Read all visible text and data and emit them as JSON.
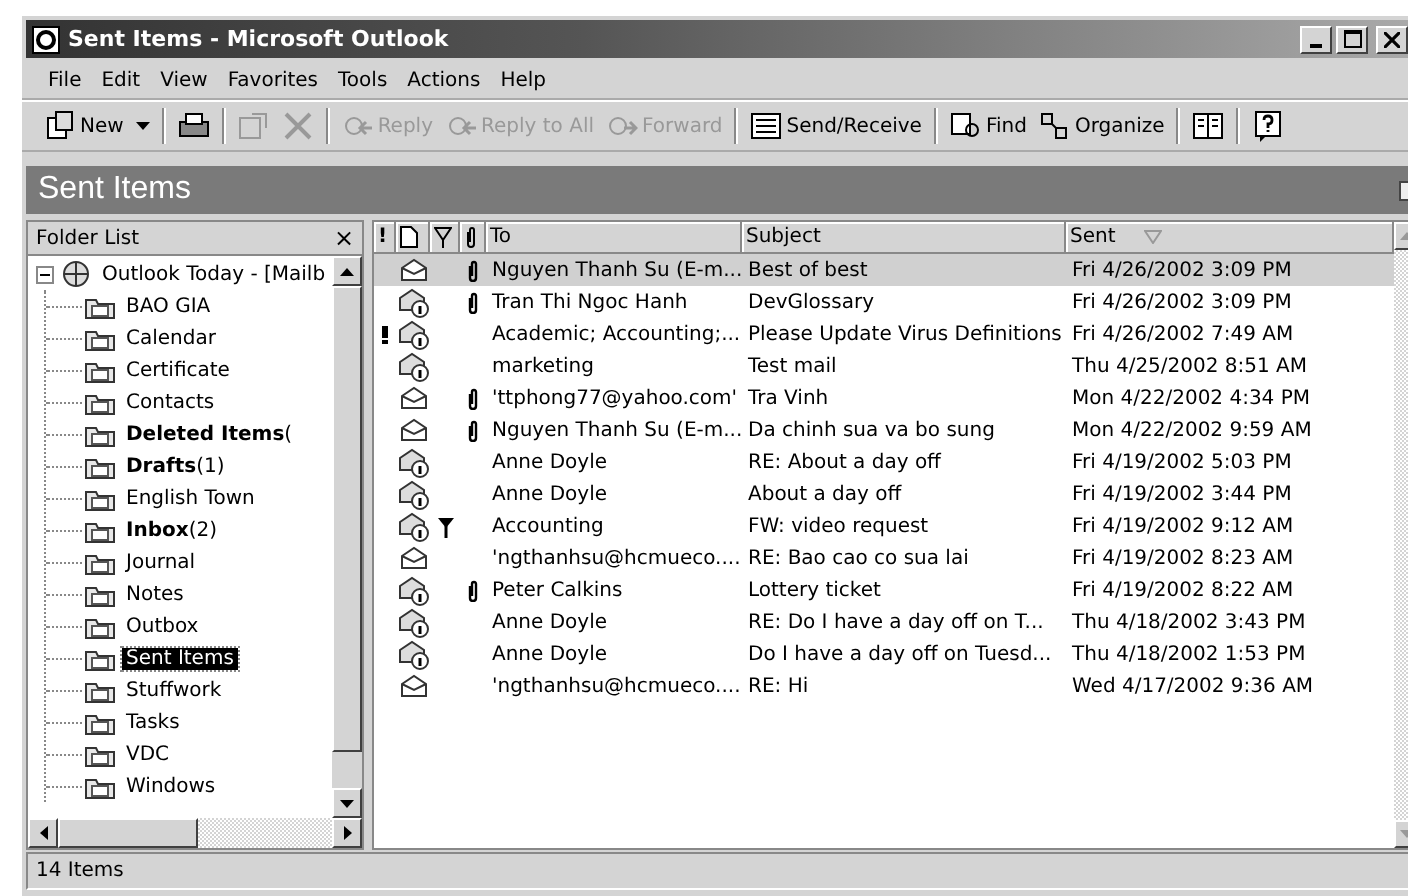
{
  "window": {
    "title": "Sent Items - Microsoft Outlook"
  },
  "menu": [
    "File",
    "Edit",
    "View",
    "Favorites",
    "Tools",
    "Actions",
    "Help"
  ],
  "toolbar": [
    {
      "kind": "button",
      "label": "New",
      "dropdown": true,
      "disabled": false
    },
    {
      "kind": "separator"
    },
    {
      "kind": "button",
      "disabled": false
    },
    {
      "kind": "separator"
    },
    {
      "kind": "button",
      "disabled": true
    },
    {
      "kind": "button",
      "disabled": true
    },
    {
      "kind": "separator"
    },
    {
      "kind": "button",
      "label": "Reply",
      "disabled": true
    },
    {
      "kind": "button",
      "label": "Reply to All",
      "disabled": true
    },
    {
      "kind": "button",
      "label": "Forward",
      "disabled": true
    },
    {
      "kind": "separator"
    },
    {
      "kind": "button",
      "label": "Send/Receive",
      "disabled": false
    },
    {
      "kind": "separator"
    },
    {
      "kind": "button",
      "label": "Find",
      "disabled": false
    },
    {
      "kind": "button",
      "label": "Organize",
      "disabled": false
    },
    {
      "kind": "separator"
    },
    {
      "kind": "button",
      "disabled": false
    },
    {
      "kind": "separator"
    },
    {
      "kind": "button",
      "disabled": false
    }
  ],
  "banner": {
    "title": "Sent Items"
  },
  "folder_list": {
    "title": "Folder List",
    "close": "×",
    "tree": [
      {
        "name": "Outlook Today - [Mailb",
        "expanded": true,
        "selected": false,
        "unread": false,
        "children": [
          {
            "name": "BAO GIA",
            "selected": false,
            "unread": false
          },
          {
            "name": "Calendar",
            "selected": false,
            "unread": false
          },
          {
            "name": "Certificate",
            "selected": false,
            "unread": false
          },
          {
            "name": "Contacts",
            "selected": false,
            "unread": false
          },
          {
            "name": "Deleted Items",
            "count": "(",
            "selected": false,
            "unread": true
          },
          {
            "name": "Drafts",
            "count": "(1)",
            "selected": false,
            "unread": true
          },
          {
            "name": "English Town",
            "selected": false,
            "unread": false
          },
          {
            "name": "Inbox",
            "count": "(2)",
            "selected": false,
            "unread": true
          },
          {
            "name": "Journal",
            "selected": false,
            "unread": false
          },
          {
            "name": "Notes",
            "selected": false,
            "unread": false
          },
          {
            "name": "Outbox",
            "selected": false,
            "unread": false
          },
          {
            "name": "Sent Items",
            "selected": true,
            "unread": false
          },
          {
            "name": "Stuffwork",
            "selected": false,
            "unread": false
          },
          {
            "name": "Tasks",
            "selected": false,
            "unread": false
          },
          {
            "name": "VDC",
            "selected": false,
            "unread": false
          },
          {
            "name": "Windows",
            "selected": false,
            "unread": false
          }
        ]
      }
    ]
  },
  "table": {
    "columns": [
      "!",
      "To",
      "Subject",
      "Sent"
    ],
    "rows": [
      {
        "kind": "plain",
        "important": false,
        "flagged": false,
        "attachment": true,
        "to": "Nguyen Thanh Su (E-m...",
        "subject": "Best of best",
        "sent": "Fri 4/26/2002 3:09 PM",
        "selected": true
      },
      {
        "kind": "info",
        "important": false,
        "flagged": false,
        "attachment": true,
        "to": "Tran Thi Ngoc Hanh",
        "subject": "DevGlossary",
        "sent": "Fri 4/26/2002 3:09 PM",
        "selected": false
      },
      {
        "kind": "info",
        "important": true,
        "flagged": false,
        "attachment": false,
        "to": "Academic; Accounting;...",
        "subject": "Please Update Virus Definitions",
        "sent": "Fri 4/26/2002 7:49 AM",
        "selected": false
      },
      {
        "kind": "info",
        "important": false,
        "flagged": false,
        "attachment": false,
        "to": "marketing",
        "subject": "Test mail",
        "sent": "Thu 4/25/2002 8:51 AM",
        "selected": false
      },
      {
        "kind": "plain",
        "important": false,
        "flagged": false,
        "attachment": true,
        "to": "'ttphong77@yahoo.com'",
        "subject": "Tra Vinh",
        "sent": "Mon 4/22/2002 4:34 PM",
        "selected": false
      },
      {
        "kind": "plain",
        "important": false,
        "flagged": false,
        "attachment": true,
        "to": "Nguyen Thanh Su (E-m...",
        "subject": "Da chinh sua va bo sung",
        "sent": "Mon 4/22/2002 9:59 AM",
        "selected": false
      },
      {
        "kind": "info",
        "important": false,
        "flagged": false,
        "attachment": false,
        "to": "Anne Doyle",
        "subject": "RE: About a day off",
        "sent": "Fri 4/19/2002 5:03 PM",
        "selected": false
      },
      {
        "kind": "info",
        "important": false,
        "flagged": false,
        "attachment": false,
        "to": "Anne Doyle",
        "subject": "About a day off",
        "sent": "Fri 4/19/2002 3:44 PM",
        "selected": false
      },
      {
        "kind": "info",
        "important": false,
        "flagged": true,
        "attachment": false,
        "to": "Accounting",
        "subject": "FW: video request",
        "sent": "Fri 4/19/2002 9:12 AM",
        "selected": false
      },
      {
        "kind": "plain",
        "important": false,
        "flagged": false,
        "attachment": false,
        "to": "'ngthanhsu@hcmueco....",
        "subject": "RE: Bao cao co sua lai",
        "sent": "Fri 4/19/2002 8:23 AM",
        "selected": false
      },
      {
        "kind": "info",
        "important": false,
        "flagged": false,
        "attachment": true,
        "to": "Peter Calkins",
        "subject": "Lottery ticket",
        "sent": "Fri 4/19/2002 8:22 AM",
        "selected": false
      },
      {
        "kind": "info",
        "important": false,
        "flagged": false,
        "attachment": false,
        "to": "Anne Doyle",
        "subject": "RE: Do I have a day off on T...",
        "sent": "Thu 4/18/2002 3:43 PM",
        "selected": false
      },
      {
        "kind": "info",
        "important": false,
        "flagged": false,
        "attachment": false,
        "to": "Anne Doyle",
        "subject": "Do I have a day off on Tuesd...",
        "sent": "Thu 4/18/2002 1:53 PM",
        "selected": false
      },
      {
        "kind": "plain",
        "important": false,
        "flagged": false,
        "attachment": false,
        "to": "'ngthanhsu@hcmueco....",
        "subject": "RE: Hi",
        "sent": "Wed 4/17/2002 9:36 AM",
        "selected": false
      }
    ]
  },
  "status_bar": {
    "text": "14 Items"
  }
}
